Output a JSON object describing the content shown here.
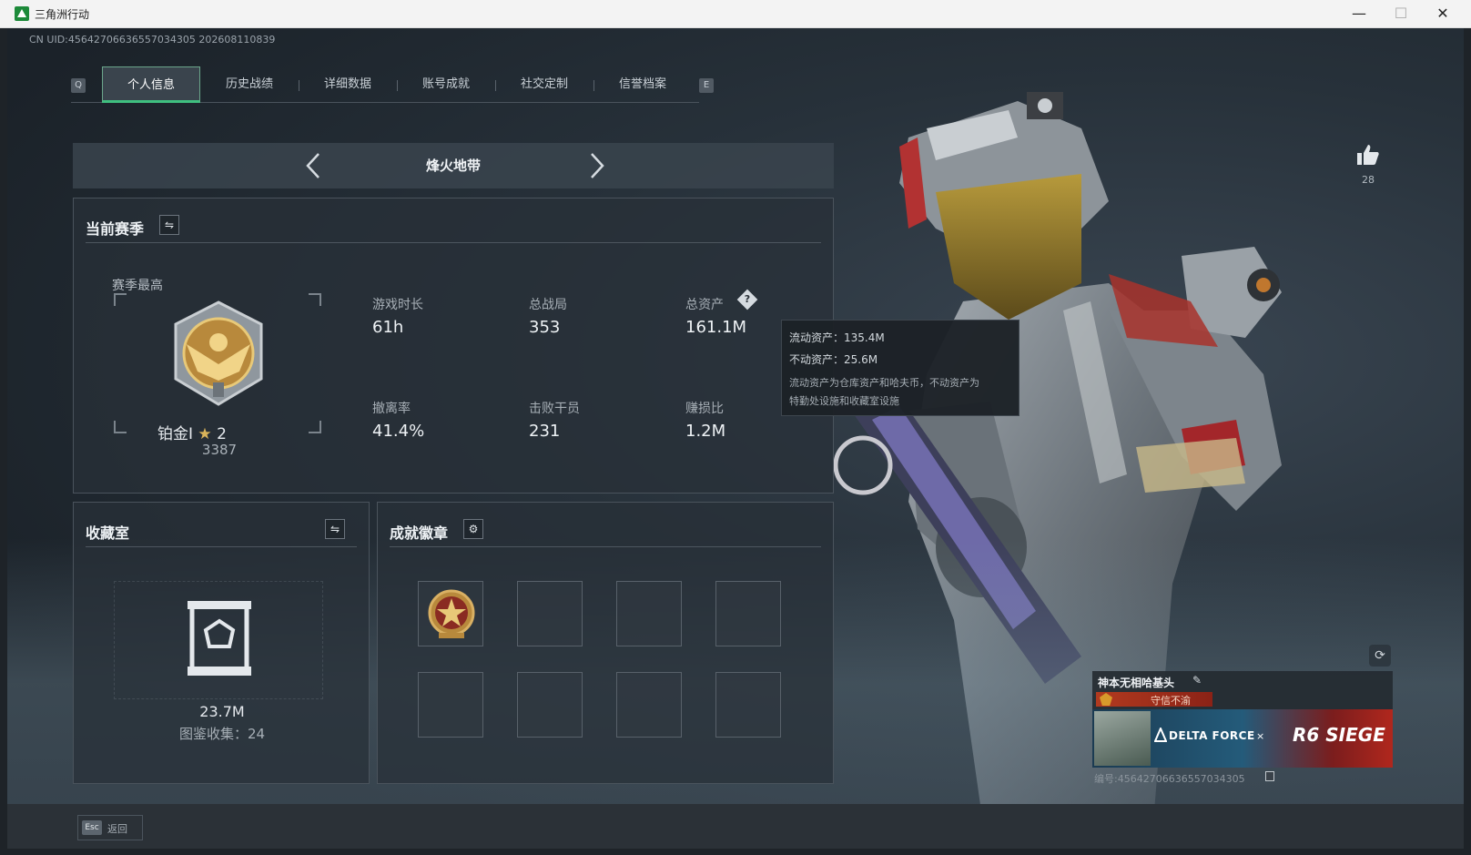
{
  "window": {
    "title": "三角洲行动",
    "minimize": "—",
    "maximize": "☐",
    "close": "✕"
  },
  "uid_line": "CN UID:4564270663655703430​5 202608110839",
  "tabs": {
    "q_key": "Q",
    "e_key": "E",
    "items": [
      {
        "label": "个人信息",
        "active": true
      },
      {
        "label": "历史战绩"
      },
      {
        "label": "详细数据"
      },
      {
        "label": "账号成就"
      },
      {
        "label": "社交定制"
      },
      {
        "label": "信誉档案"
      }
    ]
  },
  "mode": {
    "title": "烽火地带"
  },
  "season": {
    "title": "当前赛季",
    "swap_icon": "⇋",
    "best_label": "赛季最高",
    "rank_name": "铂金Ⅰ",
    "rank_star": "★",
    "rank_stars": "2",
    "rank_score": "3387",
    "stats": [
      {
        "label": "游戏时长",
        "value": "61h"
      },
      {
        "label": "总战局",
        "value": "353"
      },
      {
        "label": "总资产",
        "value": "161.1M"
      },
      {
        "label": "撤离率",
        "value": "41.4%"
      },
      {
        "label": "击败干员",
        "value": "231"
      },
      {
        "label": "赚损比",
        "value": "1.2M"
      }
    ],
    "help_icon": "?"
  },
  "tooltip": {
    "liquid": "流动资产：135.4M",
    "fixed": "不动资产：25.6M",
    "note_1": "流动资产为仓库资产和哈夫币，不动资产为",
    "note_2": "特勤处设施和收藏室设施"
  },
  "collection": {
    "title": "收藏室",
    "swap_icon": "⇋",
    "value": "23.7M",
    "count": "图鉴收集：24"
  },
  "badges": {
    "title": "成就徽章",
    "gear_icon": "⚙"
  },
  "player": {
    "like_count": "28",
    "refresh_icon": "⟳",
    "name": "神本无相哈基头",
    "edit_icon": "✎",
    "title_text": "守信不渝",
    "brand_df": "DELTA FORCE",
    "brand_x": "×",
    "brand_r6": "R6 SIEGE",
    "uid": "编号:4564270663655703430​5"
  },
  "footer": {
    "esc_key": "Esc",
    "esc_label": "返回"
  },
  "colors": {
    "accent": "#3fbf7f",
    "rank_gold": "#d8b35a",
    "title_red": "#b23a1f"
  }
}
